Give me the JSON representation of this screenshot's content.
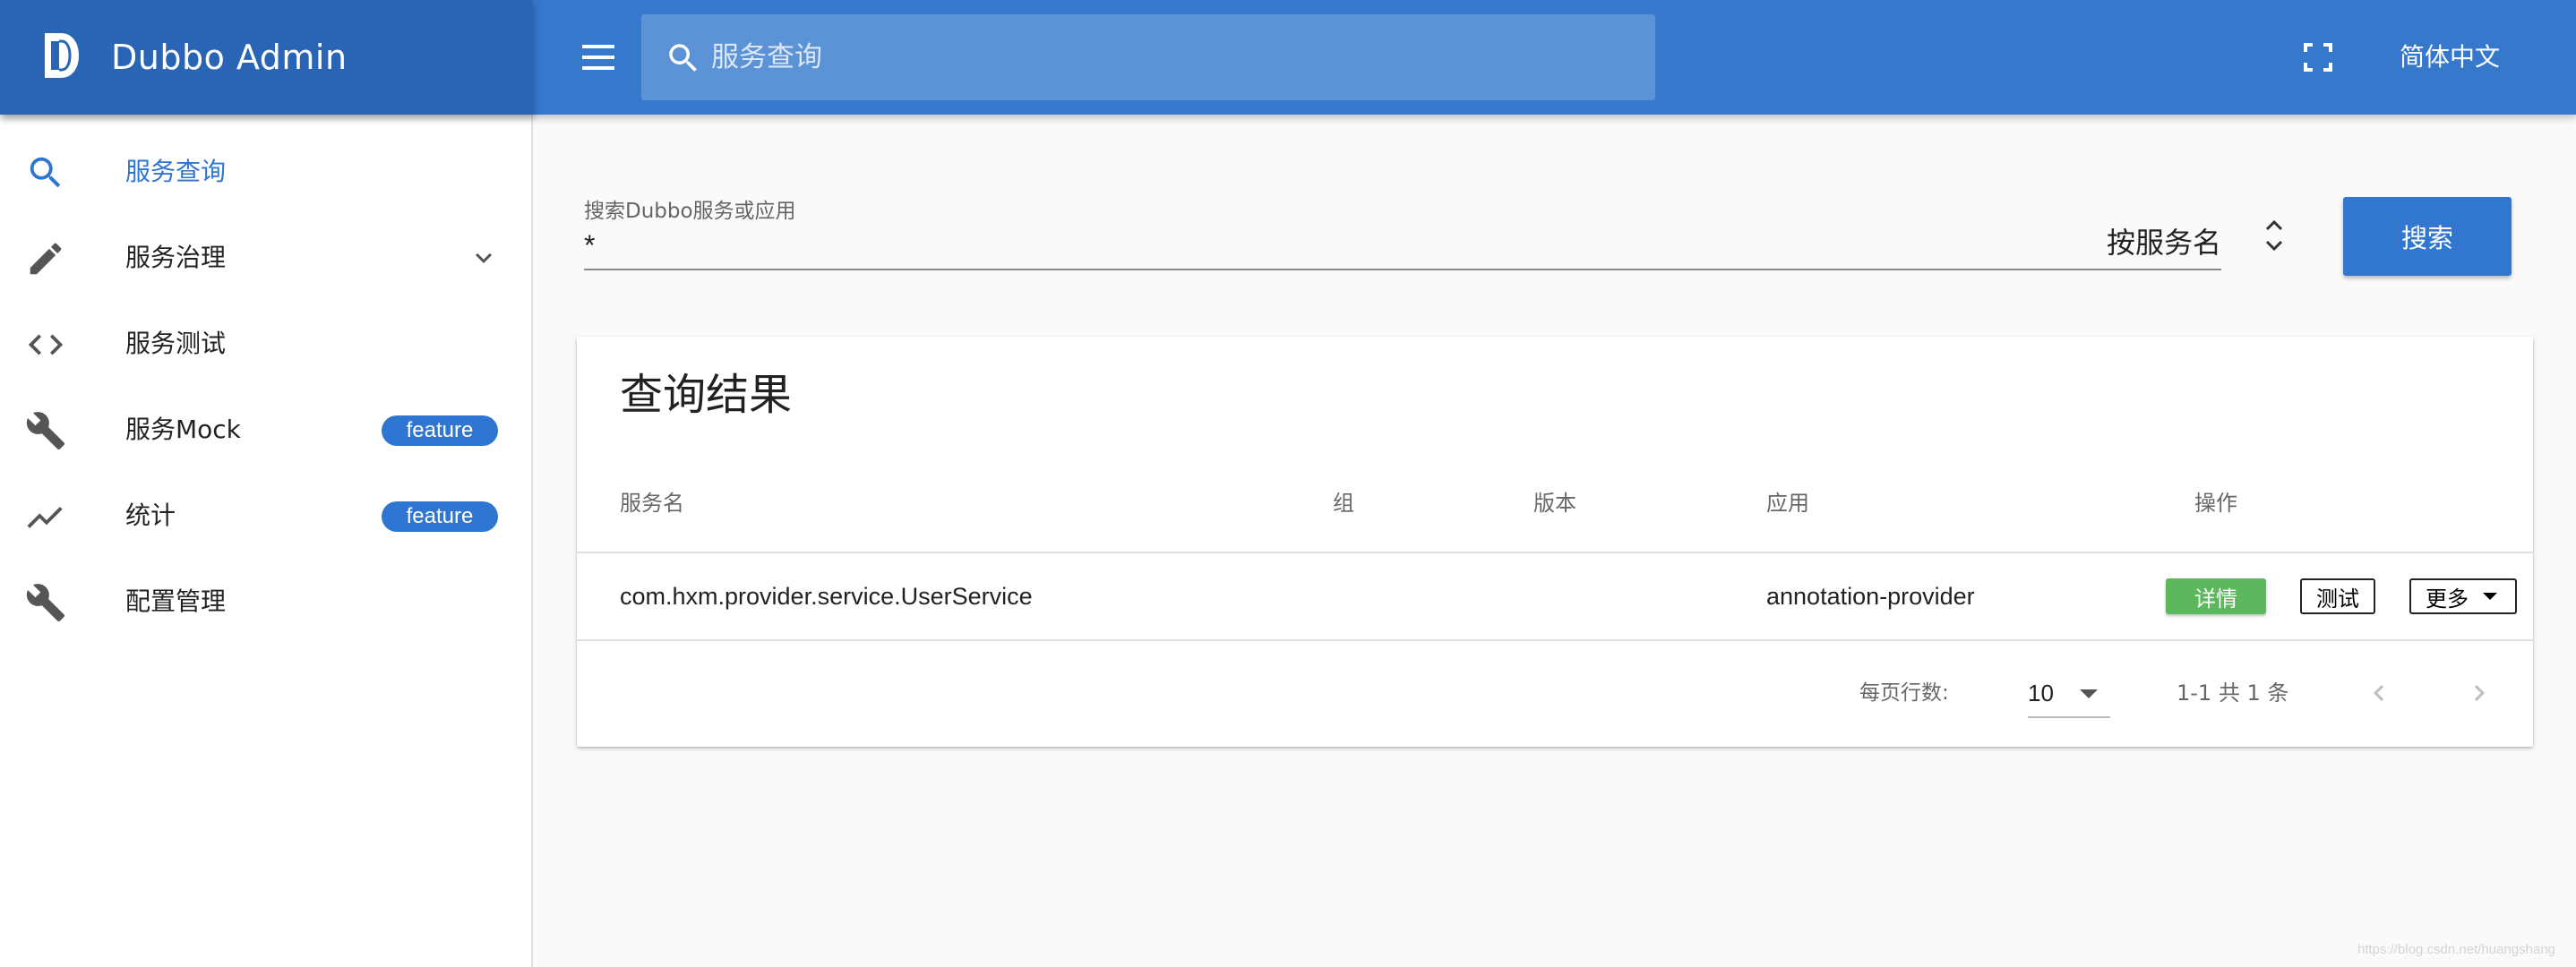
{
  "app": {
    "title": "Dubbo Admin",
    "language": "简体中文"
  },
  "topbar": {
    "search_placeholder": "服务查询"
  },
  "sidebar": {
    "items": [
      {
        "label": "服务查询",
        "icon": "search-icon",
        "active": true
      },
      {
        "label": "服务治理",
        "icon": "pencil-icon",
        "expandable": true
      },
      {
        "label": "服务测试",
        "icon": "code-icon"
      },
      {
        "label": "服务Mock",
        "icon": "wrench-icon",
        "badge": "feature"
      },
      {
        "label": "统计",
        "icon": "trend-icon",
        "badge": "feature"
      },
      {
        "label": "配置管理",
        "icon": "wrench-icon"
      }
    ]
  },
  "search": {
    "label": "搜索Dubbo服务或应用",
    "value": "*",
    "mode": "按服务名",
    "button": "搜索"
  },
  "results": {
    "title": "查询结果",
    "columns": [
      "服务名",
      "组",
      "版本",
      "应用",
      "操作"
    ],
    "rows": [
      {
        "service": "com.hxm.provider.service.UserService",
        "group": "",
        "version": "",
        "application": "annotation-provider",
        "actions": {
          "detail": "详情",
          "test": "测试",
          "more": "更多"
        }
      }
    ],
    "footer": {
      "rows_per_page_label": "每页行数:",
      "rows_per_page": "10",
      "range": "1-1 共 1 条"
    }
  },
  "watermark": "https://blog.csdn.net/huangshang",
  "colors": {
    "primary": "#3578cc",
    "brand_bg": "#2a64b4",
    "active_text": "#2f76d2",
    "detail_green": "#5cb85c"
  }
}
